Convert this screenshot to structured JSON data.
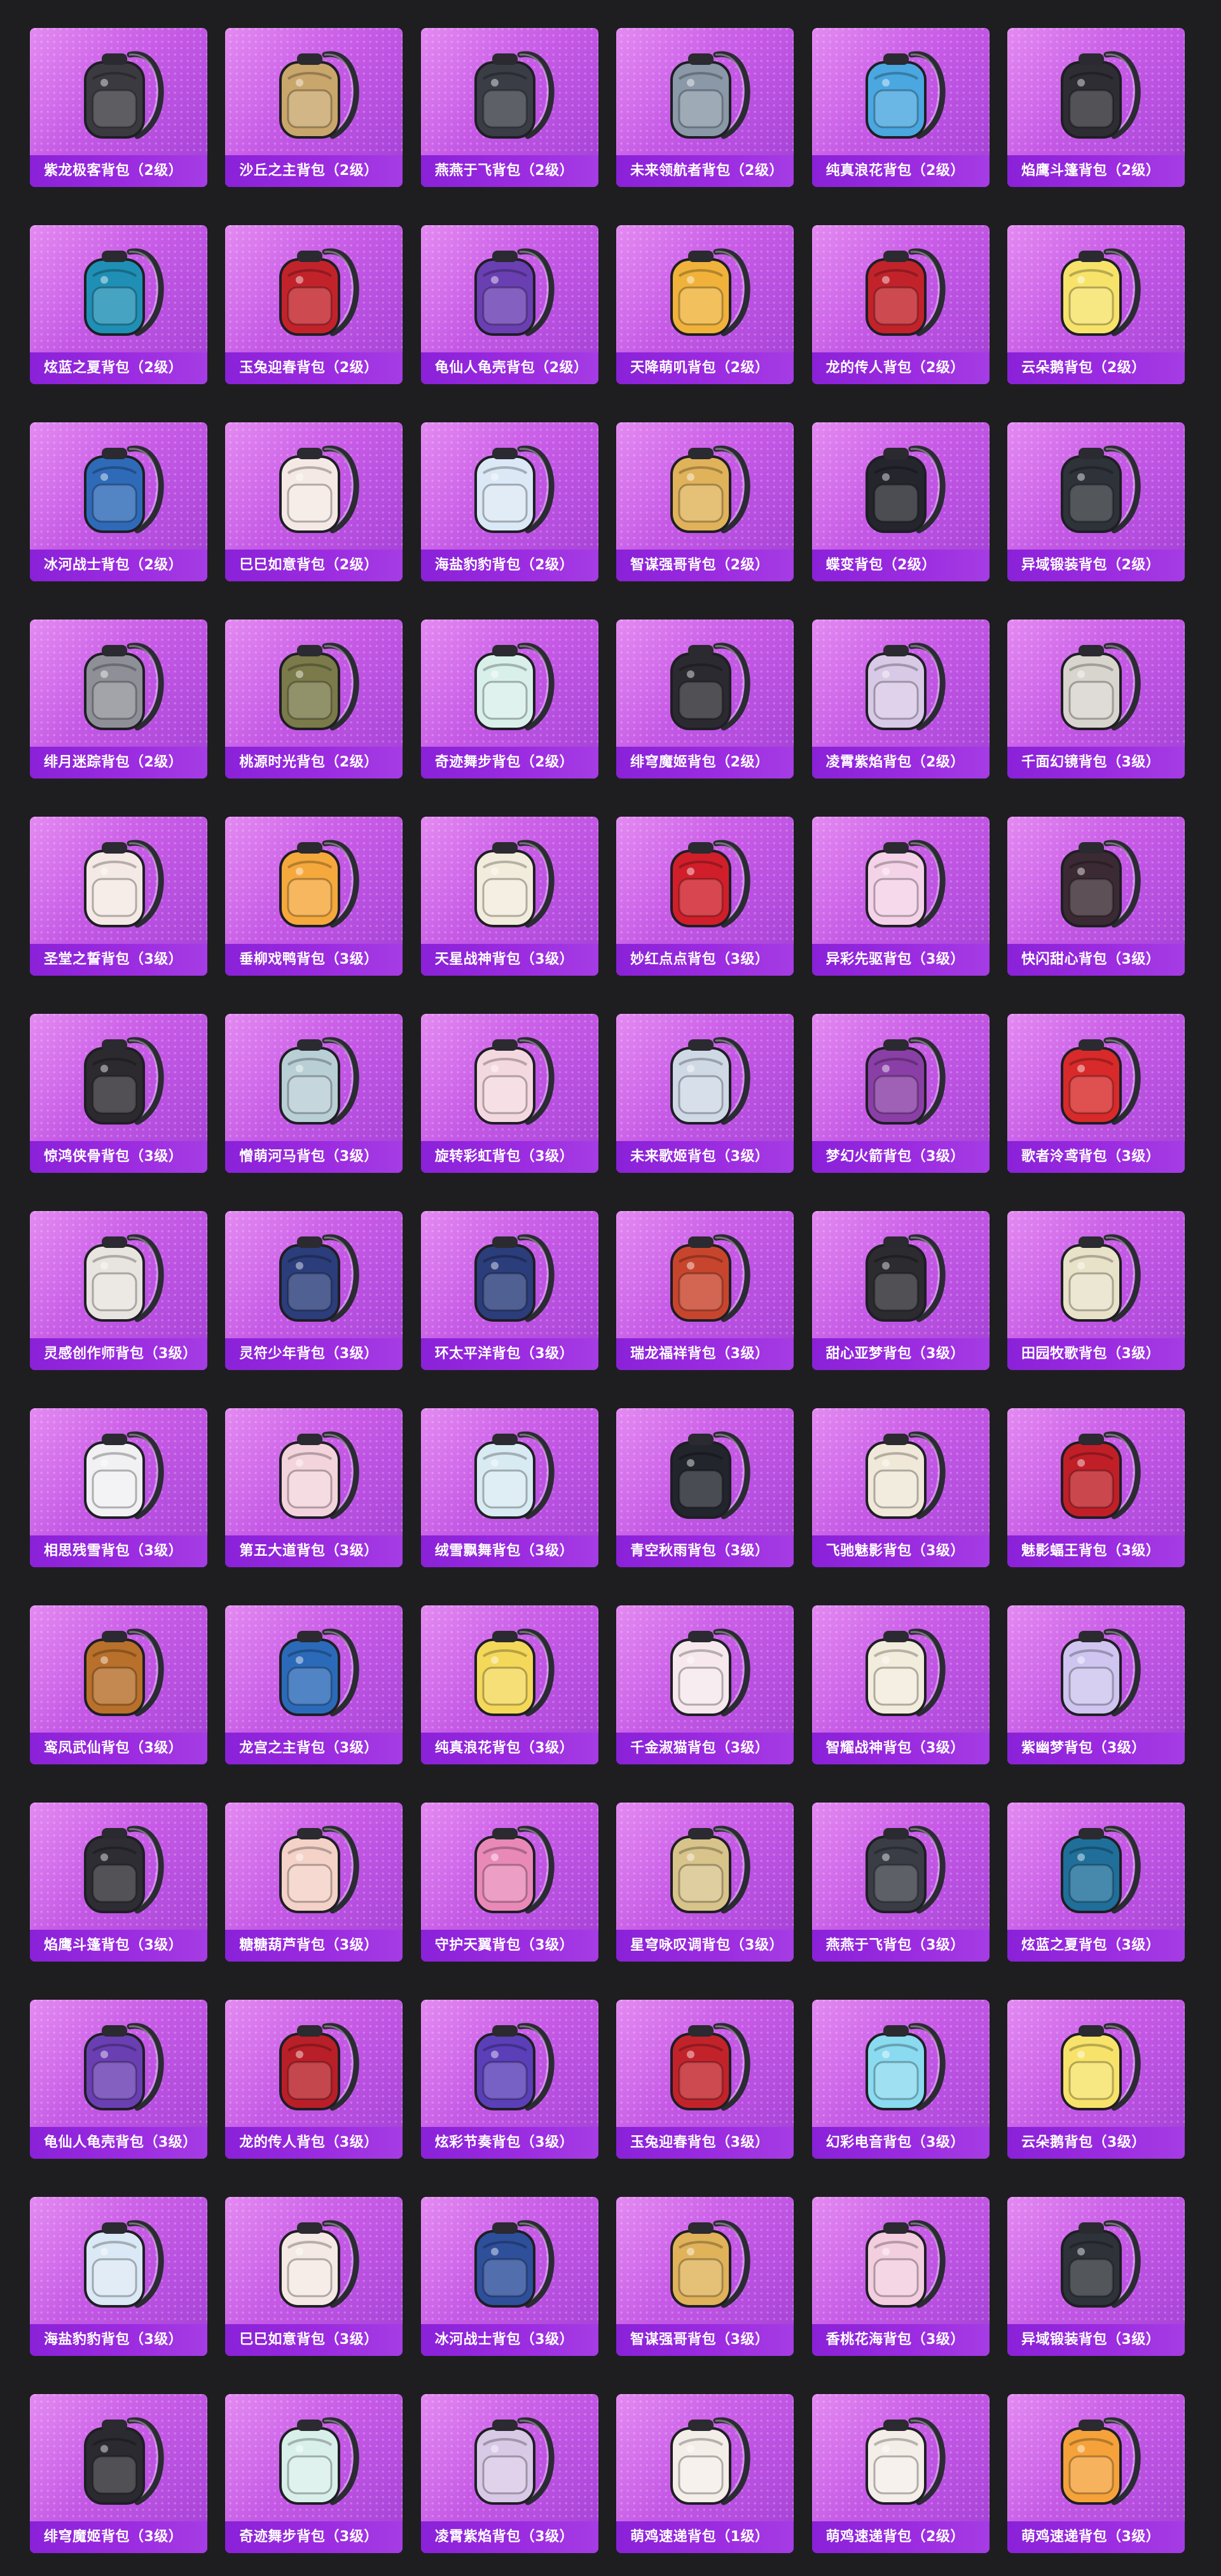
{
  "items": [
    {
      "name": "紫龙极客背包（2级）",
      "color": "#3a3a40"
    },
    {
      "name": "沙丘之主背包（2级）",
      "color": "#c9a66b"
    },
    {
      "name": "燕燕于飞背包（2级）",
      "color": "#3b3d46"
    },
    {
      "name": "未来领航者背包（2级）",
      "color": "#8a98a8"
    },
    {
      "name": "纯真浪花背包（2级）",
      "color": "#4aa7e0"
    },
    {
      "name": "焰鹰斗篷背包（2级）",
      "color": "#2d2d33"
    },
    {
      "name": "炫蓝之夏背包（2级）",
      "color": "#1f8fb5"
    },
    {
      "name": "玉兔迎春背包（2级）",
      "color": "#c2232b"
    },
    {
      "name": "龟仙人龟壳背包（2级）",
      "color": "#6a3fb2"
    },
    {
      "name": "天降萌叽背包（2级）",
      "color": "#f0b23a"
    },
    {
      "name": "龙的传人背包（2级）",
      "color": "#c2232b"
    },
    {
      "name": "云朵鹅背包（2级）",
      "color": "#f7e36a"
    },
    {
      "name": "冰河战士背包（2级）",
      "color": "#2e6ab8"
    },
    {
      "name": "巳巳如意背包（2级）",
      "color": "#f4e9e4"
    },
    {
      "name": "海盐豹豹背包（2级）",
      "color": "#dbe8f5"
    },
    {
      "name": "智谋强哥背包（2级）",
      "color": "#e0b25a"
    },
    {
      "name": "蝶变背包（2级）",
      "color": "#25262d"
    },
    {
      "name": "异域锻装背包（2级）",
      "color": "#2e3239"
    },
    {
      "name": "绯月迷踪背包（2级）",
      "color": "#8f8f98"
    },
    {
      "name": "桃源时光背包（2级）",
      "color": "#7a7a4a"
    },
    {
      "name": "奇迹舞步背包（2级）",
      "color": "#d9f0ea"
    },
    {
      "name": "绯穹魔姬背包（2级）",
      "color": "#2a2a30"
    },
    {
      "name": "凌霄紫焰背包（2级）",
      "color": "#d8c9e6"
    },
    {
      "name": "千面幻镜背包（3级）",
      "color": "#d8d4ce"
    },
    {
      "name": "圣堂之誓背包（3级）",
      "color": "#f4e9e4"
    },
    {
      "name": "垂柳戏鸭背包（3级）",
      "color": "#f5a83c"
    },
    {
      "name": "天星战神背包（3级）",
      "color": "#f2ecdc"
    },
    {
      "name": "妙红点点背包（3级）",
      "color": "#d01f2a"
    },
    {
      "name": "异彩先驱背包（3级）",
      "color": "#f4d2e8"
    },
    {
      "name": "快闪甜心背包（3级）",
      "color": "#3b2a33"
    },
    {
      "name": "惊鸿侠骨背包（3级）",
      "color": "#2d2a2f"
    },
    {
      "name": "憎萌河马背包（3级）",
      "color": "#b9cfd6"
    },
    {
      "name": "旋转彩虹背包（3级）",
      "color": "#f4d8e0"
    },
    {
      "name": "未来歌姬背包（3级）",
      "color": "#cfd9e6"
    },
    {
      "name": "梦幻火箭背包（3级）",
      "color": "#8a3fa6"
    },
    {
      "name": "歌者泠鸢背包（3级）",
      "color": "#d82a2a"
    },
    {
      "name": "灵感创作师背包（3级）",
      "color": "#e8e4df"
    },
    {
      "name": "灵符少年背包（3级）",
      "color": "#2b3d7a"
    },
    {
      "name": "环太平洋背包（3级）",
      "color": "#2b3d7a"
    },
    {
      "name": "瑞龙福祥背包（3级）",
      "color": "#c8452d"
    },
    {
      "name": "甜心亚梦背包（3级）",
      "color": "#2b2b30"
    },
    {
      "name": "田园牧歌背包（3级）",
      "color": "#e8e2c8"
    },
    {
      "name": "相思残雪背包（3级）",
      "color": "#f1f1f3"
    },
    {
      "name": "第五大道背包（3级）",
      "color": "#f3d3dc"
    },
    {
      "name": "绒雪飘舞背包（3级）",
      "color": "#d8eaf2"
    },
    {
      "name": "青空秋雨背包（3级）",
      "color": "#22252c"
    },
    {
      "name": "飞驰魅影背包（3级）",
      "color": "#f0e8d8"
    },
    {
      "name": "魅影蝠王背包（3级）",
      "color": "#c01f28"
    },
    {
      "name": "鸾凤武仙背包（3级）",
      "color": "#b8702a"
    },
    {
      "name": "龙宫之主背包（3级）",
      "color": "#2b6ab8"
    },
    {
      "name": "纯真浪花背包（3级）",
      "color": "#f4d85a"
    },
    {
      "name": "千金淑猫背包（3级）",
      "color": "#f6e8ec"
    },
    {
      "name": "智耀战神背包（3级）",
      "color": "#f2ecdc"
    },
    {
      "name": "紫幽梦背包（3级）",
      "color": "#cfc5f0"
    },
    {
      "name": "焰鹰斗篷背包（3级）",
      "color": "#2d2d33"
    },
    {
      "name": "糖糖葫芦背包（3级）",
      "color": "#f4d2c8"
    },
    {
      "name": "守护天翼背包（3级）",
      "color": "#e889b8"
    },
    {
      "name": "星穹咏叹调背包（3级）",
      "color": "#d8c48a"
    },
    {
      "name": "燕燕于飞背包（3级）",
      "color": "#3b3d46"
    },
    {
      "name": "炫蓝之夏背包（3级）",
      "color": "#1f6f9a"
    },
    {
      "name": "龟仙人龟壳背包（3级）",
      "color": "#6a3fb2"
    },
    {
      "name": "龙的传人背包（3级）",
      "color": "#b91f28"
    },
    {
      "name": "炫彩节奏背包（3级）",
      "color": "#5a3fb8"
    },
    {
      "name": "玉兔迎春背包（3级）",
      "color": "#c2232b"
    },
    {
      "name": "幻彩电音背包（3级）",
      "color": "#8adaf0"
    },
    {
      "name": "云朵鹅背包（3级）",
      "color": "#f7e36a"
    },
    {
      "name": "海盐豹豹背包（3级）",
      "color": "#dbe8f5"
    },
    {
      "name": "巳巳如意背包（3级）",
      "color": "#f4e9e4"
    },
    {
      "name": "冰河战士背包（3级）",
      "color": "#2e4f9a"
    },
    {
      "name": "智谋强哥背包（3级）",
      "color": "#e0b25a"
    },
    {
      "name": "香桃花海背包（3级）",
      "color": "#f2cede"
    },
    {
      "name": "异域锻装背包（3级）",
      "color": "#2e3239"
    },
    {
      "name": "绯穹魔姬背包（3级）",
      "color": "#2a2a30"
    },
    {
      "name": "奇迹舞步背包（3级）",
      "color": "#d9f0ea"
    },
    {
      "name": "凌霄紫焰背包（3级）",
      "color": "#d8c9e6"
    },
    {
      "name": "萌鸡速递背包（1级）",
      "color": "#f4eee8"
    },
    {
      "name": "萌鸡速递背包（2级）",
      "color": "#f4eee8"
    },
    {
      "name": "萌鸡速递背包（3级）",
      "color": "#f5a23a"
    }
  ]
}
